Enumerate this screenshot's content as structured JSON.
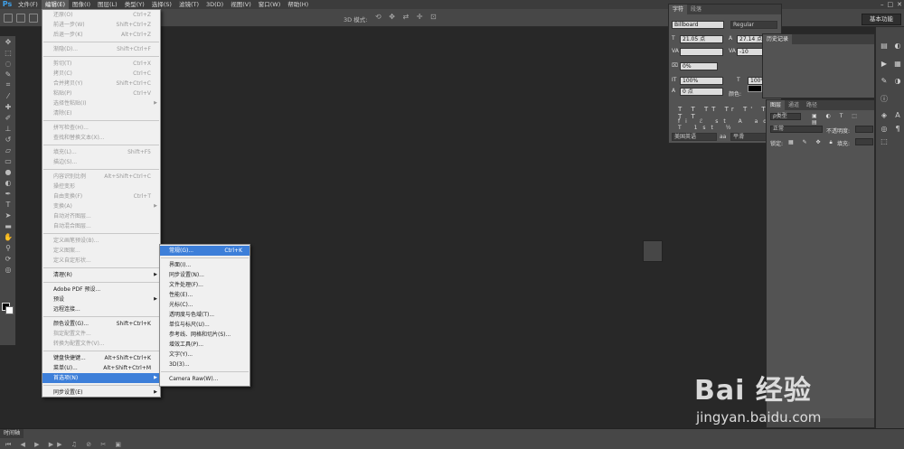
{
  "menubar": {
    "logo": "Ps",
    "items": [
      "文件(F)",
      "编辑(E)",
      "图像(I)",
      "图层(L)",
      "类型(Y)",
      "选择(S)",
      "滤镜(T)",
      "3D(D)",
      "视图(V)",
      "窗口(W)",
      "帮助(H)"
    ],
    "active_index": 1,
    "win_controls": [
      "–",
      "□",
      "✕"
    ]
  },
  "options_bar": {
    "mode_3d_label": "3D 模式:",
    "workspace_label": "基本功能"
  },
  "edit_menu": {
    "items": [
      {
        "label": "还原(O)",
        "shortcut": "Ctrl+Z",
        "disabled": true
      },
      {
        "label": "前进一步(W)",
        "shortcut": "Shift+Ctrl+Z",
        "disabled": true
      },
      {
        "label": "后退一步(K)",
        "shortcut": "Alt+Ctrl+Z",
        "disabled": true
      },
      {
        "sep": true
      },
      {
        "label": "渐隐(D)...",
        "shortcut": "Shift+Ctrl+F",
        "disabled": true
      },
      {
        "sep": true
      },
      {
        "label": "剪切(T)",
        "shortcut": "Ctrl+X",
        "disabled": true
      },
      {
        "label": "拷贝(C)",
        "shortcut": "Ctrl+C",
        "disabled": true
      },
      {
        "label": "合并拷贝(Y)",
        "shortcut": "Shift+Ctrl+C",
        "disabled": true
      },
      {
        "label": "粘贴(P)",
        "shortcut": "Ctrl+V",
        "disabled": true
      },
      {
        "label": "选择性粘贴(I)",
        "shortcut": "",
        "disabled": true,
        "submenu": true
      },
      {
        "label": "清除(E)",
        "shortcut": "",
        "disabled": true
      },
      {
        "sep": true
      },
      {
        "label": "拼写检查(H)...",
        "shortcut": "",
        "disabled": true
      },
      {
        "label": "查找和替换文本(X)...",
        "shortcut": "",
        "disabled": true
      },
      {
        "sep": true
      },
      {
        "label": "填充(L)...",
        "shortcut": "Shift+F5",
        "disabled": true
      },
      {
        "label": "描边(S)...",
        "shortcut": "",
        "disabled": true
      },
      {
        "sep": true
      },
      {
        "label": "内容识别比例",
        "shortcut": "Alt+Shift+Ctrl+C",
        "disabled": true
      },
      {
        "label": "操控变形",
        "shortcut": "",
        "disabled": true
      },
      {
        "label": "自由变换(F)",
        "shortcut": "Ctrl+T",
        "disabled": true
      },
      {
        "label": "变换(A)",
        "shortcut": "",
        "disabled": true,
        "submenu": true
      },
      {
        "label": "自动对齐图层...",
        "shortcut": "",
        "disabled": true
      },
      {
        "label": "自动混合图层...",
        "shortcut": "",
        "disabled": true
      },
      {
        "sep": true
      },
      {
        "label": "定义画笔预设(B)...",
        "shortcut": "",
        "disabled": true
      },
      {
        "label": "定义图案...",
        "shortcut": "",
        "disabled": true
      },
      {
        "label": "定义自定形状...",
        "shortcut": "",
        "disabled": true
      },
      {
        "sep": true
      },
      {
        "label": "清理(R)",
        "shortcut": "",
        "disabled": false,
        "submenu": true
      },
      {
        "sep": true
      },
      {
        "label": "Adobe PDF 预设...",
        "shortcut": "",
        "disabled": false
      },
      {
        "label": "预设",
        "shortcut": "",
        "disabled": false,
        "submenu": true
      },
      {
        "label": "远程连接...",
        "shortcut": "",
        "disabled": false
      },
      {
        "sep": true
      },
      {
        "label": "颜色设置(G)...",
        "shortcut": "Shift+Ctrl+K",
        "disabled": false
      },
      {
        "label": "指定配置文件...",
        "shortcut": "",
        "disabled": true
      },
      {
        "label": "转换为配置文件(V)...",
        "shortcut": "",
        "disabled": true
      },
      {
        "sep": true
      },
      {
        "label": "键盘快捷键...",
        "shortcut": "Alt+Shift+Ctrl+K",
        "disabled": false
      },
      {
        "label": "菜单(U)...",
        "shortcut": "Alt+Shift+Ctrl+M",
        "disabled": false
      },
      {
        "label": "首选项(N)",
        "shortcut": "",
        "disabled": false,
        "submenu": true,
        "highlighted": true
      },
      {
        "sep": true
      },
      {
        "label": "同步设置(E)",
        "shortcut": "",
        "disabled": false,
        "submenu": true
      }
    ]
  },
  "prefs_submenu": {
    "items": [
      {
        "label": "常规(G)...",
        "shortcut": "Ctrl+K",
        "highlighted": true
      },
      {
        "sep": true
      },
      {
        "label": "界面(I)..."
      },
      {
        "label": "同步设置(N)..."
      },
      {
        "label": "文件处理(F)..."
      },
      {
        "label": "性能(E)..."
      },
      {
        "label": "光标(C)..."
      },
      {
        "label": "透明度与色域(T)..."
      },
      {
        "label": "单位与标尺(U)..."
      },
      {
        "label": "参考线、网格和切片(S)..."
      },
      {
        "label": "增效工具(P)..."
      },
      {
        "label": "文字(Y)..."
      },
      {
        "label": "3D(3)..."
      },
      {
        "sep": true
      },
      {
        "label": "Camera Raw(W)..."
      }
    ]
  },
  "character_panel": {
    "tabs": [
      "字符",
      "段落"
    ],
    "font_family": "Billboard",
    "font_style": "Regular",
    "font_size": "21.05 点",
    "leading": "27.14 点",
    "tracking": "-10",
    "scale_pct": "0%",
    "vert_scale": "100%",
    "horiz_scale": "100%",
    "baseline": "0 点",
    "color_label": "颜色:",
    "language": "美国英语",
    "antialias": "平滑",
    "aa_prefix": "aa"
  },
  "history_panel": {
    "title": "历史记录"
  },
  "layers_panel": {
    "tabs": [
      "图层",
      "通道",
      "路径"
    ],
    "kind_filter": "ρ类型",
    "blend_mode": "正常",
    "opacity_label": "不透明度:",
    "lock_label": "锁定:",
    "fill_label": "填充:"
  },
  "timeline": {
    "tab": "时间轴"
  },
  "watermark": {
    "brand": "Bai 经验",
    "url": "jingyan.baidu.com"
  }
}
